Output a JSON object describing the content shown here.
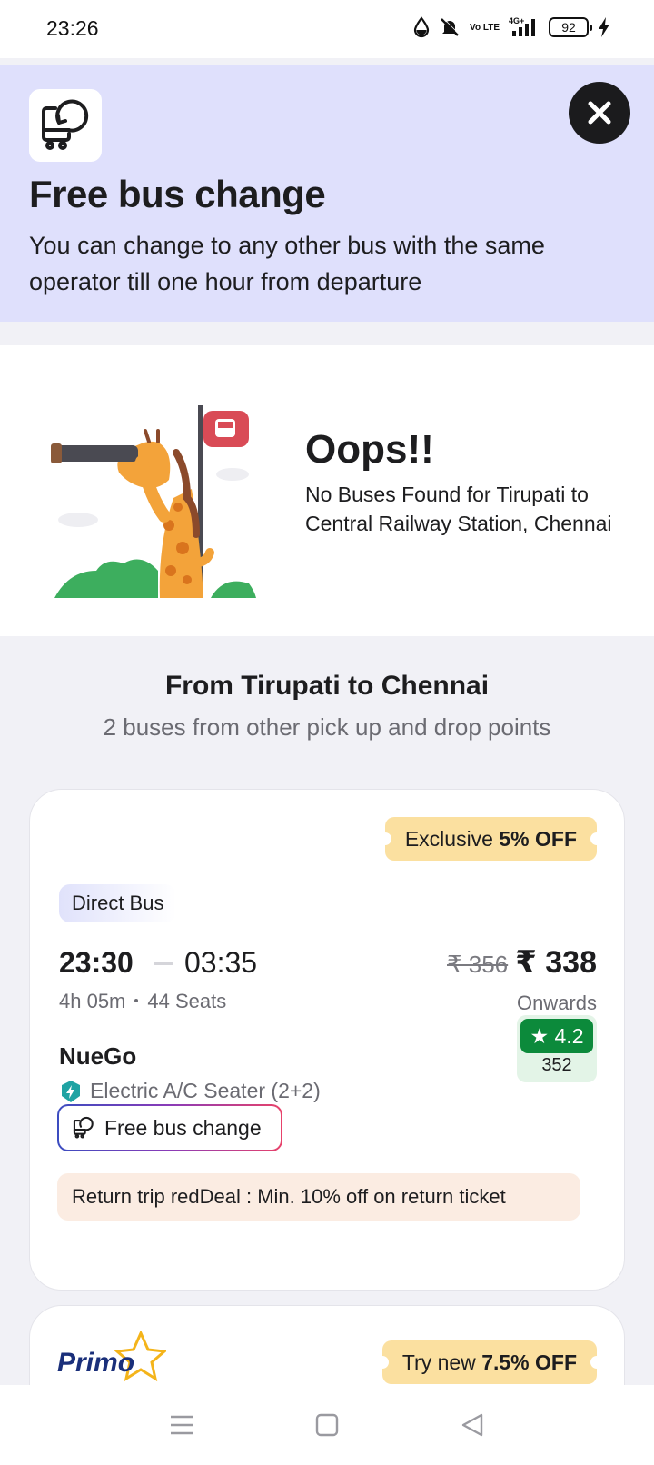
{
  "status_bar": {
    "time": "23:26",
    "network": "4G+",
    "volte": "Vo LTE",
    "battery": "92"
  },
  "banner": {
    "title": "Free bus change",
    "description": "You can change to any other bus with the same operator till one hour from departure",
    "icon": "bus-change-icon",
    "bg_color": "#dfe0fc"
  },
  "no_result": {
    "title": "Oops!!",
    "message": "No Buses Found for Tirupati to Central Railway Station, Chennai",
    "illustration": "giraffe-binoculars-illustration"
  },
  "alternatives": {
    "title": "From Tirupati to Chennai",
    "subtitle": "2 buses from other pick up and drop points"
  },
  "bus_1": {
    "offer_prefix": "Exclusive",
    "offer_value": "5% OFF",
    "badge": "Direct Bus",
    "departure": "23:30",
    "arrival": "03:35",
    "duration": "4h 05m",
    "seats": "44 Seats",
    "old_price": "₹ 356",
    "price": "₹  338",
    "price_note": "Onwards",
    "operator": "NueGo",
    "bus_type": "Electric A/C Seater (2+2)",
    "rating": "4.2",
    "rating_count": "352",
    "feature_button": "Free bus change",
    "deal": "Return trip redDeal : Min. 10% off on return ticket",
    "rating_color": "#0c8a3b"
  },
  "bus_2": {
    "operator_logo": "Primo",
    "offer_prefix": "Try new",
    "offer_value": "7.5% OFF"
  },
  "nav": {
    "menu": "menu-icon",
    "home": "home-icon",
    "back": "back-icon"
  }
}
